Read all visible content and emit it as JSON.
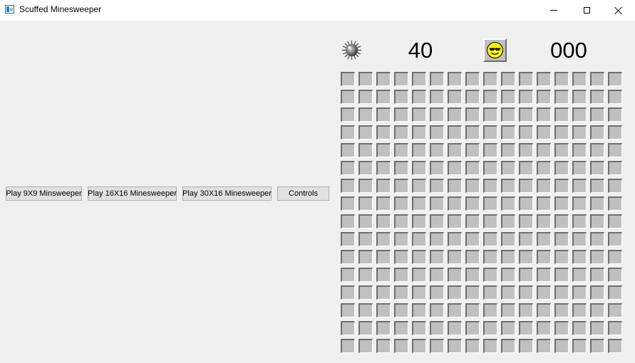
{
  "window": {
    "title": "Scuffed Minesweeper",
    "controls": [
      "minimize",
      "maximize",
      "close"
    ]
  },
  "menu": {
    "play_9x9_label": "Play 9X9 Minsweeper",
    "play_16x16_label": "Play 16X16 Minesweeper",
    "play_30x16_label": "Play 30X16 Minesweeper",
    "controls_label": "Controls"
  },
  "game": {
    "mine_icon": "mine-icon",
    "mines_remaining": "40",
    "face_state": "sunglasses-smiley-icon",
    "timer": "000",
    "board": {
      "rows": 16,
      "cols": 16,
      "cell_state": "unrevealed",
      "cell_color": "#c0c0c0"
    }
  }
}
